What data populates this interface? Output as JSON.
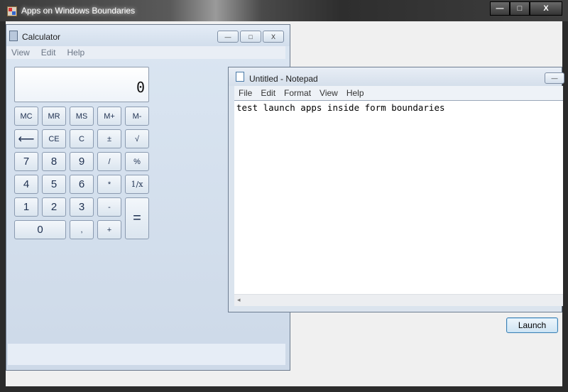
{
  "host": {
    "title": "Apps on Windows Boundaries",
    "minimize": "—",
    "maximize": "□",
    "close": "X",
    "launch_label": "Launch"
  },
  "calculator": {
    "title": "Calculator",
    "caption": {
      "minimize": "—",
      "maximize": "□",
      "close": "X"
    },
    "menu": [
      "View",
      "Edit",
      "Help"
    ],
    "display": "0",
    "buttons": {
      "mc": "MC",
      "mr": "MR",
      "ms": "MS",
      "mplus": "M+",
      "mminus": "M-",
      "backspace": "⟵",
      "ce": "CE",
      "c": "C",
      "plusminus": "±",
      "sqrt": "√",
      "n7": "7",
      "n8": "8",
      "n9": "9",
      "div": "/",
      "pct": "%",
      "n4": "4",
      "n5": "5",
      "n6": "6",
      "mul": "*",
      "recip": "1/x",
      "n1": "1",
      "n2": "2",
      "n3": "3",
      "sub": "-",
      "eq": "=",
      "n0": "0",
      "dec": ",",
      "add": "+"
    }
  },
  "notepad": {
    "title": "Untitled - Notepad",
    "caption_minimize": "—",
    "menu": [
      "File",
      "Edit",
      "Format",
      "View",
      "Help"
    ],
    "text": "test launch apps inside form boundaries",
    "scroll_left": "◂"
  }
}
